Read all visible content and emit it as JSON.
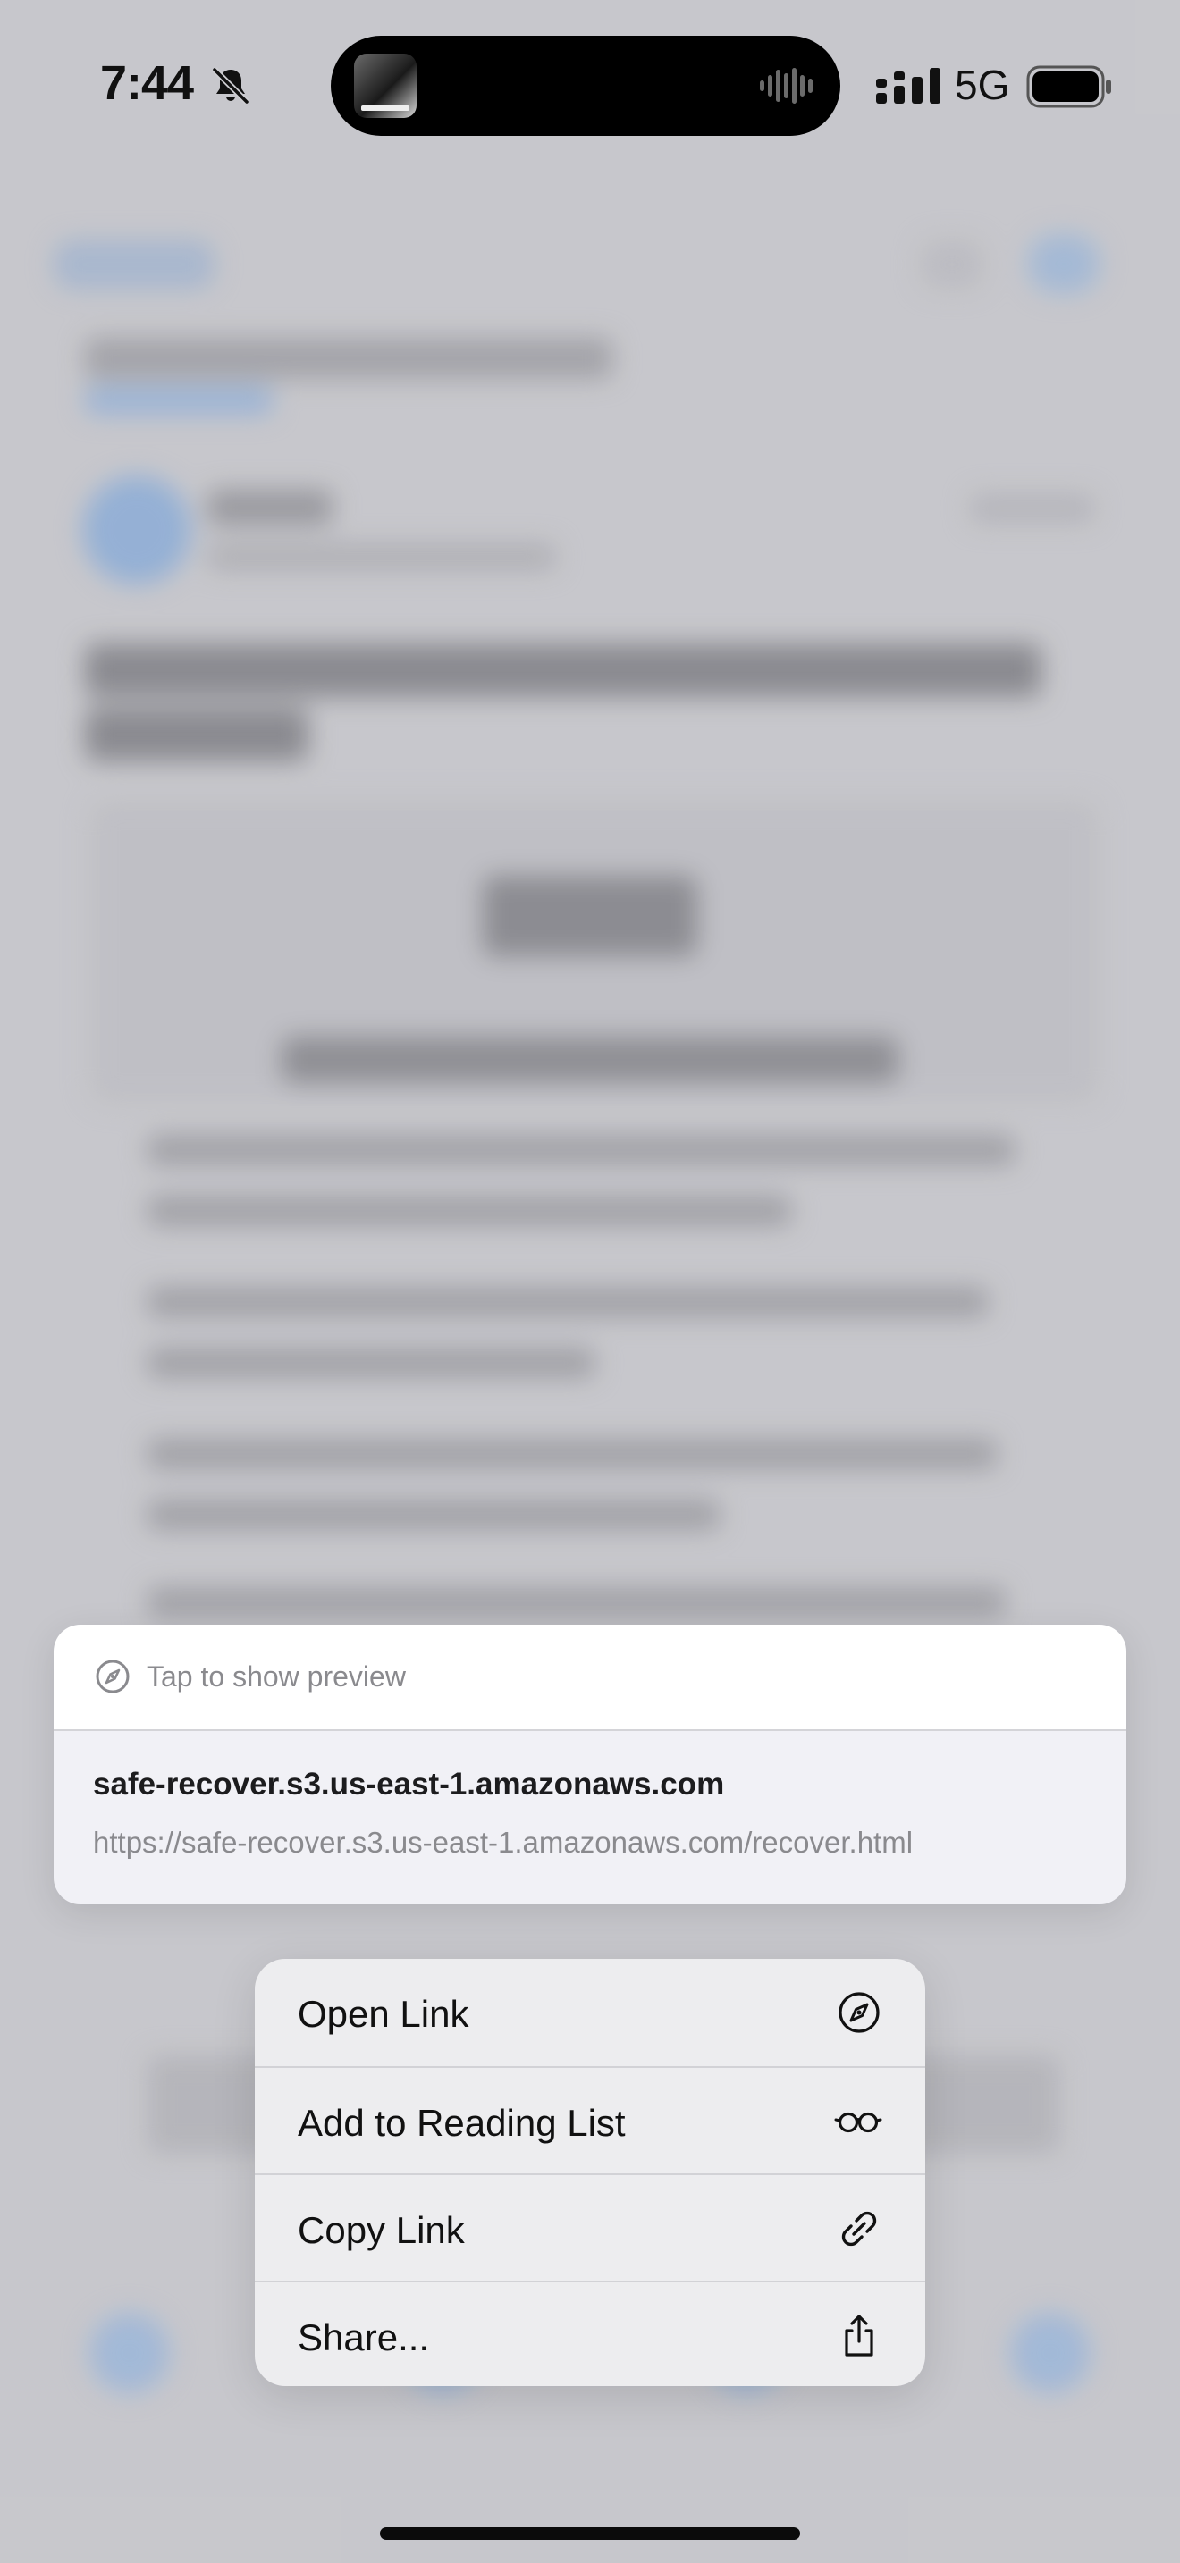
{
  "status_bar": {
    "time": "7:44",
    "network": "5G",
    "icons": [
      "bell-slash-icon",
      "signal-bars-icon",
      "battery-icon"
    ]
  },
  "dynamic_island": {
    "icons": [
      "album-art",
      "waveform-icon"
    ]
  },
  "link_preview": {
    "hint": "Tap to show preview",
    "hint_icon": "compass-icon",
    "domain": "safe-recover.s3.us-east-1.amazonaws.com",
    "url": "https://safe-recover.s3.us-east-1.amazonaws.com/recover.html"
  },
  "context_menu": {
    "items": [
      {
        "label": "Open Link",
        "icon": "compass-icon"
      },
      {
        "label": "Add to Reading List",
        "icon": "glasses-icon"
      },
      {
        "label": "Copy Link",
        "icon": "link-icon"
      },
      {
        "label": "Share...",
        "icon": "share-icon"
      }
    ]
  },
  "colors": {
    "backdrop": "#cfcfd3",
    "menu_bg": "#ededef",
    "preview_bottom": "#f1f1f6",
    "secondary_text": "#8a8a8e"
  }
}
